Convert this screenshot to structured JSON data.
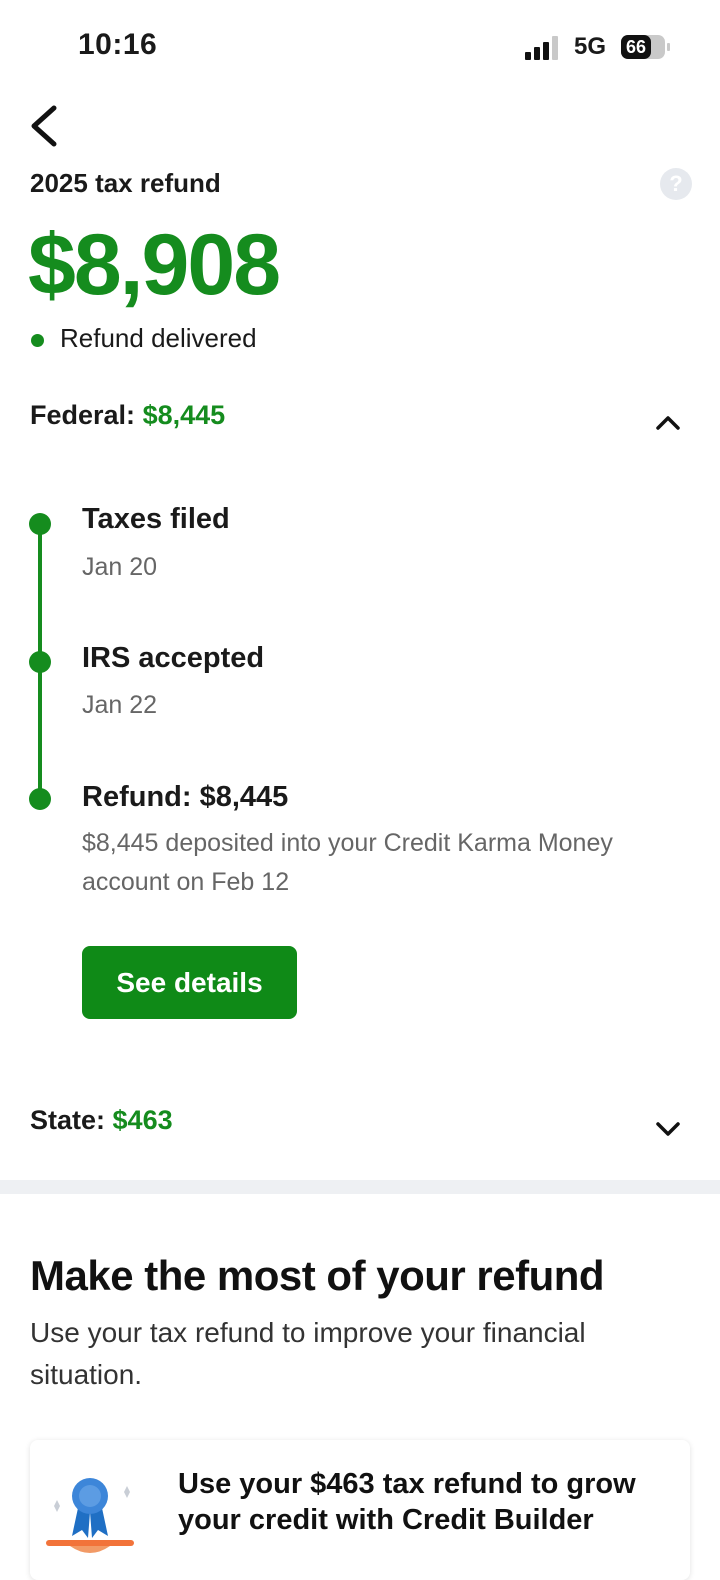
{
  "status_bar": {
    "time": "10:16",
    "network": "5G",
    "battery": "66"
  },
  "header": {
    "title": "2025 tax refund"
  },
  "refund": {
    "amount": "$8,908",
    "status": "Refund delivered"
  },
  "federal": {
    "label": "Federal:",
    "value": "$8,445"
  },
  "timeline": [
    {
      "title": "Taxes filed",
      "subtitle": "Jan 20"
    },
    {
      "title": "IRS accepted",
      "subtitle": "Jan 22"
    },
    {
      "title": "Refund: $8,445",
      "subtitle": "$8,445 deposited into your Credit Karma Money account on Feb 12"
    }
  ],
  "details_button": "See details",
  "state": {
    "label": "State:",
    "value": "$463"
  },
  "promo": {
    "title": "Make the most of your refund",
    "subtitle": "Use your tax refund to improve your financial situation.",
    "card_text": "Use your $463 tax refund to grow your credit with Credit Builder"
  },
  "colors": {
    "accent": "#158c1e",
    "button": "#0f8a17"
  }
}
